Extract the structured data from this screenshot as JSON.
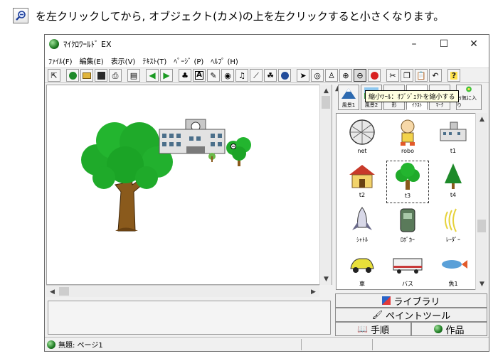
{
  "instruction": {
    "text": "を左クリックしてから, オブジェクト(カメ)の上を左クリックすると小さくなります。",
    "icon": "zoom-out-magnifier-icon"
  },
  "window": {
    "title": "ﾏｲｸﾛﾜｰﾙﾄﾞ EX",
    "minimize": "–",
    "maximize": "☐",
    "close": "✕"
  },
  "menu": {
    "file": "ﾌｧｲﾙ(F)",
    "edit": "編集(E)",
    "view": "表示(V)",
    "text": "ﾃｷｽﾄ(T)",
    "page": "ﾍﾟｰｼﾞ (P)",
    "help": "ﾍﾙﾌﾟ (H)"
  },
  "tooltip": "縮小ﾂｰﾙ：ｵﾌﾞｼﾞｪｸﾄを縮小する",
  "tabs": {
    "scenery1": "風景1",
    "scenery2": "風景2",
    "shape": "形",
    "illust": "ｲﾗｽﾄ",
    "mark": "ﾏｰｸ",
    "favorites": "お気に入り"
  },
  "library": {
    "items": [
      {
        "label": "net",
        "icon": "net-ball-icon"
      },
      {
        "label": "robo",
        "icon": "robot-icon"
      },
      {
        "label": "t1",
        "icon": "school-building-icon"
      },
      {
        "label": "t2",
        "icon": "house-icon"
      },
      {
        "label": "t3",
        "icon": "tree-icon"
      },
      {
        "label": "t4",
        "icon": "conifer-tree-icon"
      },
      {
        "label": "ｼｬﾄﾙ",
        "icon": "space-shuttle-icon"
      },
      {
        "label": "ﾛﾎﾞｶｰ",
        "icon": "robot-car-icon"
      },
      {
        "label": "ﾚｰﾀﾞｰ",
        "icon": "radar-waves-icon"
      },
      {
        "label": "車",
        "icon": "car-icon"
      },
      {
        "label": "バス",
        "icon": "bus-icon"
      },
      {
        "label": "魚1",
        "icon": "fish-icon"
      }
    ],
    "selected_index": 4
  },
  "panel": {
    "library_btn": "ライブラリ",
    "paint_btn": "ペイントツール",
    "steps_btn": "手順",
    "works_btn": "作品"
  },
  "status": {
    "text": "無題: ページ1"
  },
  "colors": {
    "tree_green": "#1faa2a",
    "trunk_brown": "#8a5a1c",
    "tooltip_bg": "#ffffe1"
  }
}
